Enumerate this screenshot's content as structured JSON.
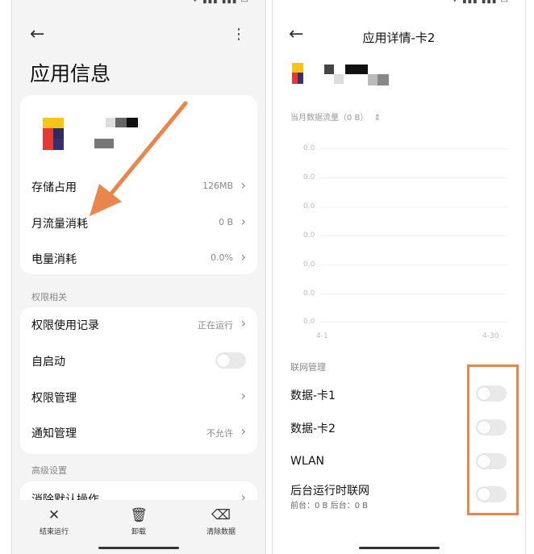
{
  "left": {
    "title": "应用信息",
    "items_top": [
      {
        "label": "存储占用",
        "value": "126MB"
      },
      {
        "label": "月流量消耗",
        "value": "0 B"
      },
      {
        "label": "电量消耗",
        "value": "0.0%"
      }
    ],
    "section_permissions": "权限相关",
    "items_perm": [
      {
        "label": "权限使用记录",
        "value": "正在运行"
      },
      {
        "label": "自启动",
        "value": ""
      },
      {
        "label": "权限管理",
        "value": ""
      },
      {
        "label": "通知管理",
        "value": "不允许"
      }
    ],
    "autostart_on": false,
    "section_advanced": "高级设置",
    "partial_item": "消除默认操作",
    "bottom": [
      {
        "label": "结束运行",
        "icon": "close-icon"
      },
      {
        "label": "卸载",
        "icon": "trash-icon"
      },
      {
        "label": "清除数据",
        "icon": "eraser-icon"
      }
    ]
  },
  "right": {
    "title": "应用详情-卡2",
    "data_selector": "当月数据流量（0 B）",
    "chart_data": {
      "type": "line",
      "x_start": "4-1",
      "x_end": "4-30",
      "y_ticks": [
        "0.0",
        "0.0",
        "0.0",
        "0.0",
        "0.0",
        "0.0",
        "0.0"
      ],
      "values": []
    },
    "section_network": "联网管理",
    "network_rows": [
      {
        "label": "数据-卡1",
        "on": false
      },
      {
        "label": "数据-卡2",
        "on": false
      },
      {
        "label": "WLAN",
        "on": false
      },
      {
        "label": "后台运行时联网",
        "on": false
      }
    ],
    "background_usage": "前台：0 B  后台：0 B"
  },
  "colors": {
    "annotation": "#e8864e",
    "toggle_off": "#e9e9e9"
  }
}
